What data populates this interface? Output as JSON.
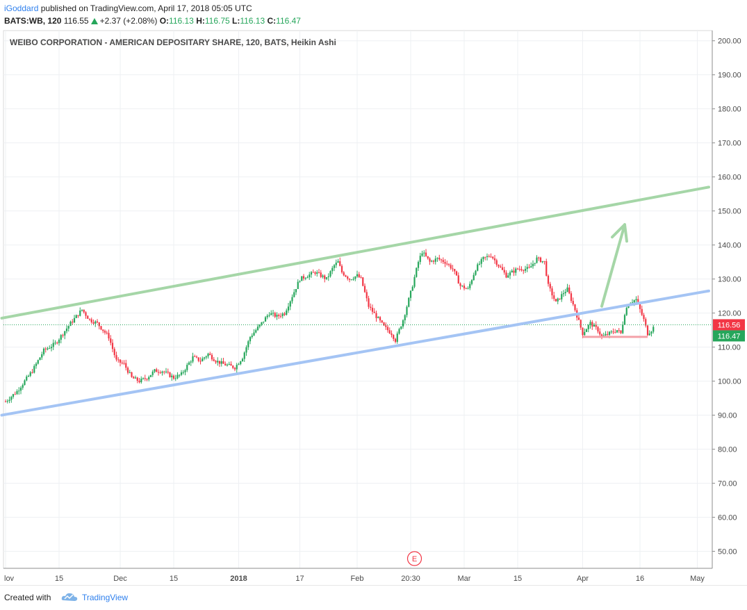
{
  "header": {
    "author": "iGoddard",
    "published_text": "published on TradingView.com, April 17, 2018 05:05 UTC",
    "symbol": "BATS:WB, 120",
    "last": "116.55",
    "change": "+2.37 (+2.08%)",
    "o_label": "O:",
    "o_value": "116.13",
    "h_label": "H:",
    "h_value": "116.75",
    "l_label": "L:",
    "l_value": "116.13",
    "c_label": "C:",
    "c_value": "116.47"
  },
  "chart_data": {
    "type": "candlestick",
    "title": "WEIBO CORPORATION - AMERICAN DEPOSITARY SHARE, 120, BATS, Heikin Ashi",
    "xlabel": "",
    "ylabel": "",
    "ylim": [
      45,
      203
    ],
    "y_ticks": [
      "200.00",
      "190.00",
      "180.00",
      "170.00",
      "160.00",
      "150.00",
      "140.00",
      "130.00",
      "120.00",
      "110.00",
      "100.00",
      "90.00",
      "80.00",
      "70.00",
      "60.00",
      "50.00"
    ],
    "x_ticks": [
      {
        "label": "lov",
        "day": 0,
        "bold": false
      },
      {
        "label": "15",
        "day": 14,
        "bold": false
      },
      {
        "label": "Dec",
        "day": 30,
        "bold": false
      },
      {
        "label": "15",
        "day": 44,
        "bold": false
      },
      {
        "label": "2018",
        "day": 61,
        "bold": true
      },
      {
        "label": "17",
        "day": 77,
        "bold": false
      },
      {
        "label": "Feb",
        "day": 92,
        "bold": false
      },
      {
        "label": "20:30",
        "day": 106,
        "bold": false
      },
      {
        "label": "Mar",
        "day": 120,
        "bold": false
      },
      {
        "label": "15",
        "day": 134,
        "bold": false
      },
      {
        "label": "Apr",
        "day": 151,
        "bold": false
      },
      {
        "label": "16",
        "day": 166,
        "bold": false
      },
      {
        "label": "May",
        "day": 181,
        "bold": false
      }
    ],
    "grid": true,
    "colors": {
      "up": "#26a65b",
      "down": "#f23645",
      "upper_line": "#a5d6a7",
      "lower_line": "#a4c4f4",
      "support": "#f4a0a8",
      "arrow": "#a5d6a7",
      "last_label": "#f23645",
      "close_label": "#26a65b"
    },
    "price_labels": {
      "last": "116.56",
      "close": "116.47"
    },
    "last_price": 116.56,
    "close_price": 116.47,
    "path": [
      {
        "day": 0,
        "price": 94
      },
      {
        "day": 3,
        "price": 97
      },
      {
        "day": 7,
        "price": 103
      },
      {
        "day": 10,
        "price": 109
      },
      {
        "day": 13,
        "price": 111
      },
      {
        "day": 15,
        "price": 114
      },
      {
        "day": 17,
        "price": 117
      },
      {
        "day": 20,
        "price": 121
      },
      {
        "day": 22,
        "price": 118
      },
      {
        "day": 24,
        "price": 117
      },
      {
        "day": 27,
        "price": 113
      },
      {
        "day": 29,
        "price": 106
      },
      {
        "day": 31,
        "price": 105
      },
      {
        "day": 33,
        "price": 101
      },
      {
        "day": 35,
        "price": 100
      },
      {
        "day": 37,
        "price": 101
      },
      {
        "day": 39,
        "price": 103
      },
      {
        "day": 41,
        "price": 103
      },
      {
        "day": 44,
        "price": 101
      },
      {
        "day": 46,
        "price": 102
      },
      {
        "day": 49,
        "price": 107
      },
      {
        "day": 51,
        "price": 106
      },
      {
        "day": 53,
        "price": 108
      },
      {
        "day": 55,
        "price": 106
      },
      {
        "day": 57,
        "price": 105
      },
      {
        "day": 60,
        "price": 104
      },
      {
        "day": 62,
        "price": 107
      },
      {
        "day": 64,
        "price": 113
      },
      {
        "day": 67,
        "price": 117
      },
      {
        "day": 69,
        "price": 120
      },
      {
        "day": 71,
        "price": 119
      },
      {
        "day": 73,
        "price": 120
      },
      {
        "day": 75,
        "price": 125
      },
      {
        "day": 77,
        "price": 130
      },
      {
        "day": 79,
        "price": 131
      },
      {
        "day": 81,
        "price": 132
      },
      {
        "day": 84,
        "price": 130
      },
      {
        "day": 86,
        "price": 134
      },
      {
        "day": 87,
        "price": 135
      },
      {
        "day": 88,
        "price": 132
      },
      {
        "day": 90,
        "price": 130
      },
      {
        "day": 92,
        "price": 131
      },
      {
        "day": 93,
        "price": 130
      },
      {
        "day": 95,
        "price": 122
      },
      {
        "day": 97,
        "price": 119
      },
      {
        "day": 99,
        "price": 116
      },
      {
        "day": 101,
        "price": 114
      },
      {
        "day": 102,
        "price": 112
      },
      {
        "day": 104,
        "price": 118
      },
      {
        "day": 106,
        "price": 126
      },
      {
        "day": 108,
        "price": 135
      },
      {
        "day": 109,
        "price": 138
      },
      {
        "day": 111,
        "price": 135
      },
      {
        "day": 113,
        "price": 136
      },
      {
        "day": 115,
        "price": 135
      },
      {
        "day": 117,
        "price": 133
      },
      {
        "day": 119,
        "price": 128
      },
      {
        "day": 121,
        "price": 127
      },
      {
        "day": 123,
        "price": 133
      },
      {
        "day": 125,
        "price": 136
      },
      {
        "day": 127,
        "price": 137
      },
      {
        "day": 129,
        "price": 134
      },
      {
        "day": 131,
        "price": 131
      },
      {
        "day": 134,
        "price": 133
      },
      {
        "day": 137,
        "price": 133
      },
      {
        "day": 139,
        "price": 136
      },
      {
        "day": 141,
        "price": 135
      },
      {
        "day": 142,
        "price": 128
      },
      {
        "day": 144,
        "price": 123
      },
      {
        "day": 146,
        "price": 126
      },
      {
        "day": 147,
        "price": 127
      },
      {
        "day": 149,
        "price": 121
      },
      {
        "day": 151,
        "price": 114
      },
      {
        "day": 153,
        "price": 117
      },
      {
        "day": 155,
        "price": 115
      },
      {
        "day": 156,
        "price": 113
      },
      {
        "day": 158,
        "price": 114
      },
      {
        "day": 160,
        "price": 115
      },
      {
        "day": 161,
        "price": 114
      },
      {
        "day": 162,
        "price": 120
      },
      {
        "day": 163,
        "price": 123
      },
      {
        "day": 165,
        "price": 124
      },
      {
        "day": 166,
        "price": 121
      },
      {
        "day": 167,
        "price": 118
      },
      {
        "day": 168,
        "price": 114
      },
      {
        "day": 169,
        "price": 115
      },
      {
        "day": 170,
        "price": 116.5
      }
    ],
    "upper_trendline": {
      "start": [
        -1,
        118.5
      ],
      "end": [
        184,
        157
      ]
    },
    "lower_trendline": {
      "start": [
        -1,
        90
      ],
      "end": [
        184,
        126.5
      ]
    },
    "support_line": {
      "start": [
        151,
        113
      ],
      "end": [
        168,
        113
      ],
      "label": ""
    },
    "arrow": {
      "start": [
        156,
        122
      ],
      "end": [
        162,
        146
      ]
    },
    "event_marker": {
      "day": 107,
      "label": "E"
    }
  },
  "footer": {
    "created_with": "Created with",
    "brand": "TradingView"
  }
}
